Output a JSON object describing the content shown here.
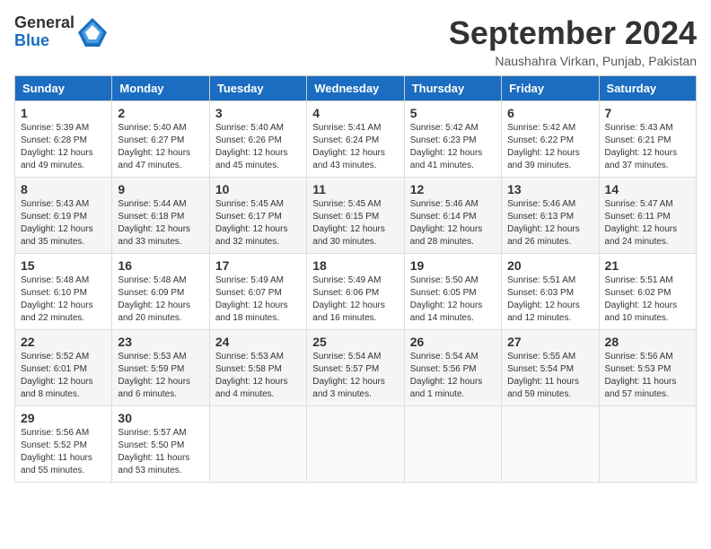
{
  "logo": {
    "general": "General",
    "blue": "Blue"
  },
  "title": "September 2024",
  "location": "Naushahra Virkan, Punjab, Pakistan",
  "weekdays": [
    "Sunday",
    "Monday",
    "Tuesday",
    "Wednesday",
    "Thursday",
    "Friday",
    "Saturday"
  ],
  "weeks": [
    [
      {
        "day": 1,
        "sunrise": "5:39 AM",
        "sunset": "6:28 PM",
        "daylight": "12 hours and 49 minutes."
      },
      {
        "day": 2,
        "sunrise": "5:40 AM",
        "sunset": "6:27 PM",
        "daylight": "12 hours and 47 minutes."
      },
      {
        "day": 3,
        "sunrise": "5:40 AM",
        "sunset": "6:26 PM",
        "daylight": "12 hours and 45 minutes."
      },
      {
        "day": 4,
        "sunrise": "5:41 AM",
        "sunset": "6:24 PM",
        "daylight": "12 hours and 43 minutes."
      },
      {
        "day": 5,
        "sunrise": "5:42 AM",
        "sunset": "6:23 PM",
        "daylight": "12 hours and 41 minutes."
      },
      {
        "day": 6,
        "sunrise": "5:42 AM",
        "sunset": "6:22 PM",
        "daylight": "12 hours and 39 minutes."
      },
      {
        "day": 7,
        "sunrise": "5:43 AM",
        "sunset": "6:21 PM",
        "daylight": "12 hours and 37 minutes."
      }
    ],
    [
      {
        "day": 8,
        "sunrise": "5:43 AM",
        "sunset": "6:19 PM",
        "daylight": "12 hours and 35 minutes."
      },
      {
        "day": 9,
        "sunrise": "5:44 AM",
        "sunset": "6:18 PM",
        "daylight": "12 hours and 33 minutes."
      },
      {
        "day": 10,
        "sunrise": "5:45 AM",
        "sunset": "6:17 PM",
        "daylight": "12 hours and 32 minutes."
      },
      {
        "day": 11,
        "sunrise": "5:45 AM",
        "sunset": "6:15 PM",
        "daylight": "12 hours and 30 minutes."
      },
      {
        "day": 12,
        "sunrise": "5:46 AM",
        "sunset": "6:14 PM",
        "daylight": "12 hours and 28 minutes."
      },
      {
        "day": 13,
        "sunrise": "5:46 AM",
        "sunset": "6:13 PM",
        "daylight": "12 hours and 26 minutes."
      },
      {
        "day": 14,
        "sunrise": "5:47 AM",
        "sunset": "6:11 PM",
        "daylight": "12 hours and 24 minutes."
      }
    ],
    [
      {
        "day": 15,
        "sunrise": "5:48 AM",
        "sunset": "6:10 PM",
        "daylight": "12 hours and 22 minutes."
      },
      {
        "day": 16,
        "sunrise": "5:48 AM",
        "sunset": "6:09 PM",
        "daylight": "12 hours and 20 minutes."
      },
      {
        "day": 17,
        "sunrise": "5:49 AM",
        "sunset": "6:07 PM",
        "daylight": "12 hours and 18 minutes."
      },
      {
        "day": 18,
        "sunrise": "5:49 AM",
        "sunset": "6:06 PM",
        "daylight": "12 hours and 16 minutes."
      },
      {
        "day": 19,
        "sunrise": "5:50 AM",
        "sunset": "6:05 PM",
        "daylight": "12 hours and 14 minutes."
      },
      {
        "day": 20,
        "sunrise": "5:51 AM",
        "sunset": "6:03 PM",
        "daylight": "12 hours and 12 minutes."
      },
      {
        "day": 21,
        "sunrise": "5:51 AM",
        "sunset": "6:02 PM",
        "daylight": "12 hours and 10 minutes."
      }
    ],
    [
      {
        "day": 22,
        "sunrise": "5:52 AM",
        "sunset": "6:01 PM",
        "daylight": "12 hours and 8 minutes."
      },
      {
        "day": 23,
        "sunrise": "5:53 AM",
        "sunset": "5:59 PM",
        "daylight": "12 hours and 6 minutes."
      },
      {
        "day": 24,
        "sunrise": "5:53 AM",
        "sunset": "5:58 PM",
        "daylight": "12 hours and 4 minutes."
      },
      {
        "day": 25,
        "sunrise": "5:54 AM",
        "sunset": "5:57 PM",
        "daylight": "12 hours and 3 minutes."
      },
      {
        "day": 26,
        "sunrise": "5:54 AM",
        "sunset": "5:56 PM",
        "daylight": "12 hours and 1 minute."
      },
      {
        "day": 27,
        "sunrise": "5:55 AM",
        "sunset": "5:54 PM",
        "daylight": "11 hours and 59 minutes."
      },
      {
        "day": 28,
        "sunrise": "5:56 AM",
        "sunset": "5:53 PM",
        "daylight": "11 hours and 57 minutes."
      }
    ],
    [
      {
        "day": 29,
        "sunrise": "5:56 AM",
        "sunset": "5:52 PM",
        "daylight": "11 hours and 55 minutes."
      },
      {
        "day": 30,
        "sunrise": "5:57 AM",
        "sunset": "5:50 PM",
        "daylight": "11 hours and 53 minutes."
      },
      null,
      null,
      null,
      null,
      null
    ]
  ]
}
